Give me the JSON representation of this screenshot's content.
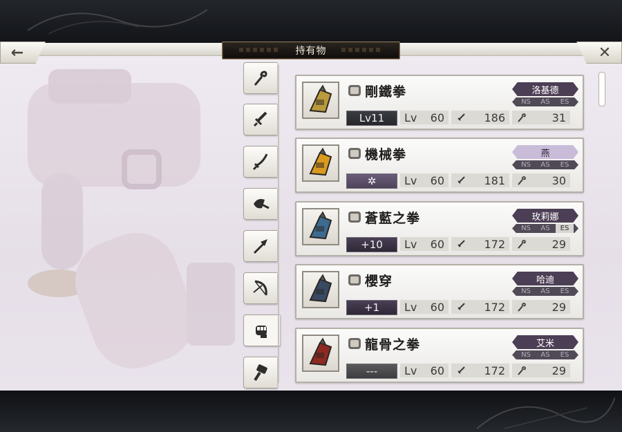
{
  "header": {
    "title": "持有物",
    "back_icon": "←",
    "close_icon": "✕"
  },
  "tabs": [
    {
      "name": "tab-staff",
      "icon": "staff-icon",
      "active": false
    },
    {
      "name": "tab-sword",
      "icon": "sword-icon",
      "active": false
    },
    {
      "name": "tab-katana",
      "icon": "katana-icon",
      "active": false
    },
    {
      "name": "tab-axe",
      "icon": "axe-icon",
      "active": false
    },
    {
      "name": "tab-spear",
      "icon": "spear-icon",
      "active": false
    },
    {
      "name": "tab-bow",
      "icon": "bow-icon",
      "active": false
    },
    {
      "name": "tab-fist",
      "icon": "fist-icon",
      "active": true
    },
    {
      "name": "tab-hammer",
      "icon": "hammer-icon",
      "active": false
    }
  ],
  "items": [
    {
      "name": "剛鐵拳",
      "owner": "洛基德",
      "owner_style": "dark",
      "badge": "Lv11",
      "badge_style": "lv",
      "lv_label": "Lv",
      "lv": "60",
      "atk": "186",
      "mag": "31",
      "flags": [
        "NS",
        "AS",
        "ES"
      ],
      "flags_on": [
        false,
        false,
        false
      ],
      "thumb_color": "#b99a3c"
    },
    {
      "name": "機械拳",
      "owner": "燕",
      "owner_style": "light",
      "badge": "✲",
      "badge_style": "star",
      "lv_label": "Lv",
      "lv": "60",
      "atk": "181",
      "mag": "30",
      "flags": [
        "NS",
        "AS",
        "ES"
      ],
      "flags_on": [
        false,
        false,
        false
      ],
      "thumb_color": "#d99b1f"
    },
    {
      "name": "蒼藍之拳",
      "owner": "玫莉娜",
      "owner_style": "dark",
      "badge": "+10",
      "badge_style": "plus",
      "lv_label": "Lv",
      "lv": "60",
      "atk": "172",
      "mag": "29",
      "flags": [
        "NS",
        "AS",
        "ES"
      ],
      "flags_on": [
        false,
        false,
        true
      ],
      "thumb_color": "#3d6a8f"
    },
    {
      "name": "櫻穿",
      "owner": "哈迪",
      "owner_style": "dark",
      "badge": "+1",
      "badge_style": "plus",
      "lv_label": "Lv",
      "lv": "60",
      "atk": "172",
      "mag": "29",
      "flags": [
        "NS",
        "AS",
        "ES"
      ],
      "flags_on": [
        false,
        false,
        false
      ],
      "thumb_color": "#3a4a63"
    },
    {
      "name": "龍骨之拳",
      "owner": "艾米",
      "owner_style": "dark",
      "badge": "---",
      "badge_style": "dash",
      "lv_label": "Lv",
      "lv": "60",
      "atk": "172",
      "mag": "29",
      "flags": [
        "NS",
        "AS",
        "ES"
      ],
      "flags_on": [
        false,
        false,
        false
      ],
      "thumb_color": "#8f2a22"
    }
  ]
}
